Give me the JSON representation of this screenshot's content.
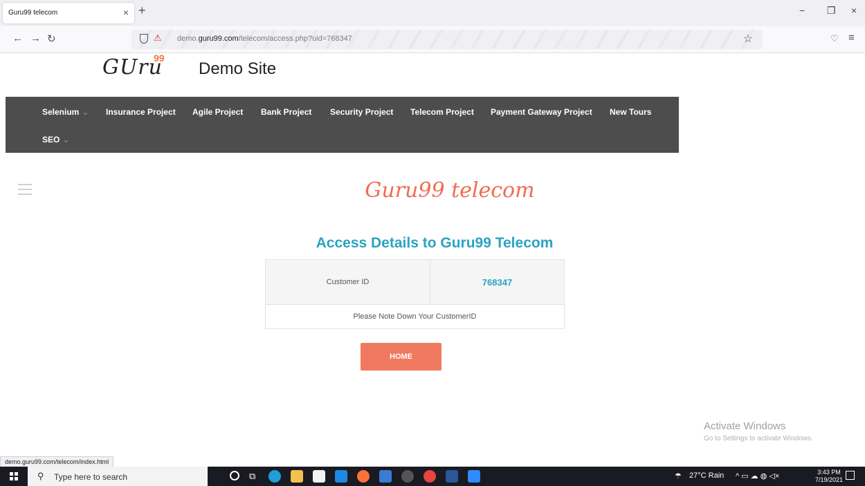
{
  "browser": {
    "tab_title": "Guru99 telecom",
    "tab_close": "×",
    "new_tab": "+",
    "win_minimize": "−",
    "win_restore": "❐",
    "win_close": "×",
    "back": "←",
    "forward": "→",
    "reload": "↻",
    "url_prefix": "demo.",
    "url_domain": "guru99.com",
    "url_path": "/telecom/access.php?uid=768347",
    "bookmark_star": "☆",
    "pocket": "♡",
    "menu": "≡",
    "status_url": "demo.guru99.com/telecom/index.html"
  },
  "header": {
    "logo_text": "GUru",
    "logo_sup": "99",
    "site_title": "Demo Site"
  },
  "nav": {
    "items": [
      {
        "label": "Selenium",
        "dropdown": true
      },
      {
        "label": "Insurance Project",
        "dropdown": false
      },
      {
        "label": "Agile Project",
        "dropdown": false
      },
      {
        "label": "Bank Project",
        "dropdown": false
      },
      {
        "label": "Security Project",
        "dropdown": false
      },
      {
        "label": "Telecom Project",
        "dropdown": false
      },
      {
        "label": "Payment Gateway Project",
        "dropdown": false
      },
      {
        "label": "New Tours",
        "dropdown": false
      },
      {
        "label": "SEO",
        "dropdown": true
      }
    ],
    "caret": "⌄"
  },
  "main": {
    "brand": "Guru99 telecom",
    "heading": "Access Details to Guru99 Telecom",
    "customer_id_label": "Customer ID",
    "customer_id_value": "768347",
    "note": "Please Note Down Your CustomerID",
    "home_button": "HOME"
  },
  "watermark": {
    "line1": "Activate Windows",
    "line2": "Go to Settings to activate Windows."
  },
  "taskbar": {
    "search_icon": "⚲",
    "search_placeholder": "Type here to search",
    "weather": "27°C Rain",
    "tray_icons": "^ ▭ ☁ ◍ ◁×",
    "time": "3:43 PM",
    "date": "7/19/2021",
    "task_view": "⧉"
  },
  "colors": {
    "nav_bg": "#4d4d4d",
    "brand": "#ef6c50",
    "heading": "#2aa3c2",
    "button": "#f07a5f",
    "taskbar": "#1a1a22"
  }
}
